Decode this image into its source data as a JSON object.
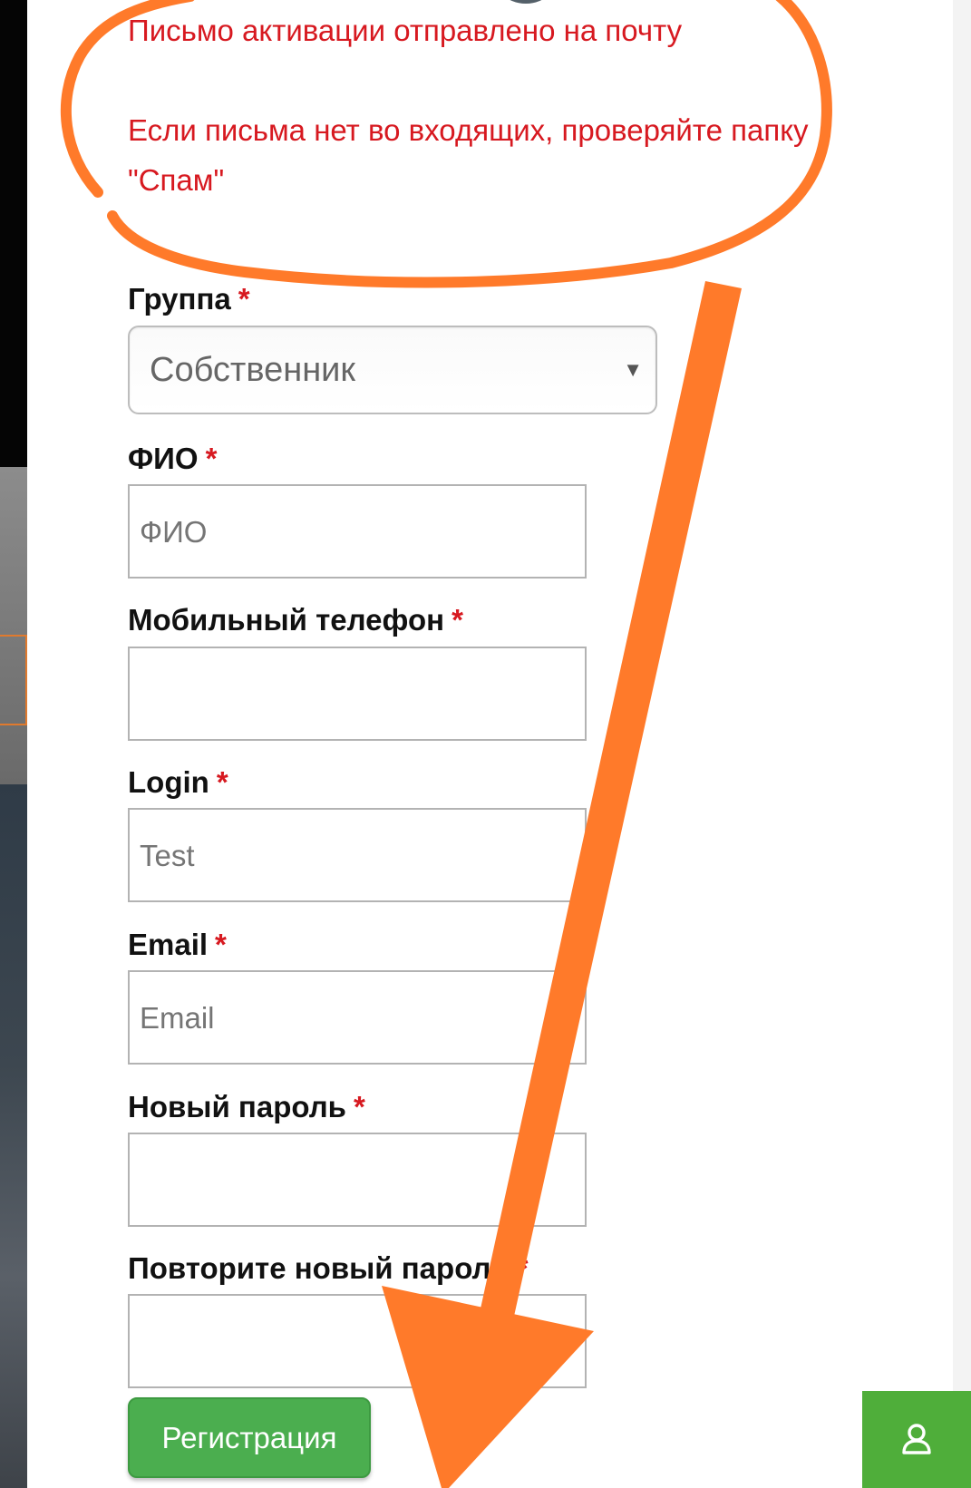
{
  "notice": {
    "line1": "Письмо активации отправлено на почту",
    "line2": "Если письма нет во входящих, проверяйте папку \"Спам\""
  },
  "form": {
    "group": {
      "label": "Группа",
      "required_mark": "*",
      "selected": "Собственник",
      "caret": "▼"
    },
    "fio": {
      "label": "ФИО",
      "required_mark": "*",
      "placeholder": "ФИО"
    },
    "phone": {
      "label": "Мобильный телефон",
      "required_mark": "*",
      "placeholder": ""
    },
    "login": {
      "label": "Login",
      "required_mark": "*",
      "placeholder": "Test"
    },
    "email": {
      "label": "Email",
      "required_mark": "*",
      "placeholder": "Email"
    },
    "new_password": {
      "label": "Новый пароль",
      "required_mark": "*",
      "placeholder": ""
    },
    "repeat_password": {
      "label": "Повторите новый пароль",
      "required_mark": "*",
      "placeholder": ""
    },
    "submit_label": "Регистрация"
  },
  "icons": {
    "user_button": "user-icon"
  },
  "colors": {
    "notice_text": "#d71920",
    "annotation": "#ff7a2a",
    "register_button": "#4bae4f",
    "user_button": "#4fae3a"
  }
}
